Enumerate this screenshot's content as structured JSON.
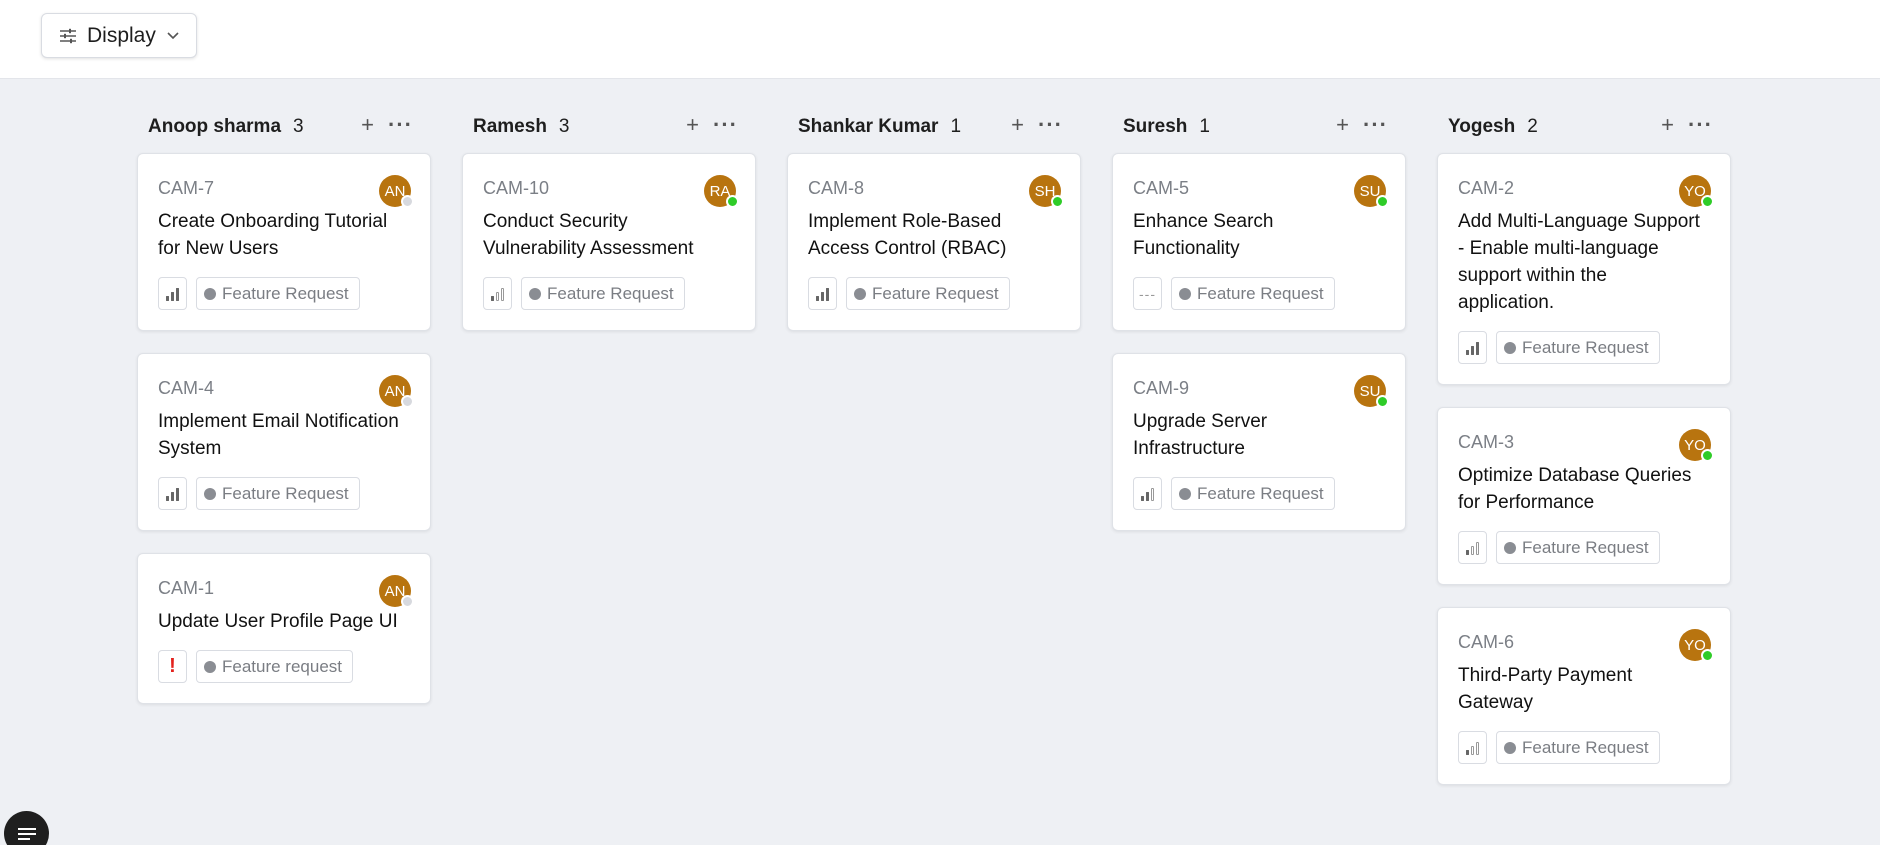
{
  "toolbar": {
    "display_label": "Display",
    "display_icon": "sliders-icon",
    "chevron_icon": "chevron-down-icon"
  },
  "columns": [
    {
      "name": "Anoop sharma",
      "count": "3",
      "cards": [
        {
          "id": "CAM-7",
          "title": "Create Onboarding Tutorial for New Users",
          "avatar": "AN",
          "presence": "offline",
          "priority": "high",
          "label": "Feature Request"
        },
        {
          "id": "CAM-4",
          "title": "Implement Email Notification System",
          "avatar": "AN",
          "presence": "offline",
          "priority": "high",
          "label": "Feature Request"
        },
        {
          "id": "CAM-1",
          "title": "Update User Profile Page UI",
          "avatar": "AN",
          "presence": "offline",
          "priority": "urgent",
          "label": "Feature request"
        }
      ]
    },
    {
      "name": "Ramesh",
      "count": "3",
      "cards": [
        {
          "id": "CAM-10",
          "title": "Conduct Security Vulnerability Assessment",
          "avatar": "RA",
          "presence": "online",
          "priority": "low",
          "label": "Feature Request"
        }
      ]
    },
    {
      "name": "Shankar Kumar",
      "count": "1",
      "cards": [
        {
          "id": "CAM-8",
          "title": "Implement Role-Based Access Control (RBAC)",
          "avatar": "SH",
          "presence": "online",
          "priority": "high",
          "label": "Feature Request"
        }
      ]
    },
    {
      "name": "Suresh",
      "count": "1",
      "cards": [
        {
          "id": "CAM-5",
          "title": "Enhance Search Functionality",
          "avatar": "SU",
          "presence": "online",
          "priority": "none",
          "label": "Feature Request"
        },
        {
          "id": "CAM-9",
          "title": "Upgrade Server Infrastructure",
          "avatar": "SU",
          "presence": "online",
          "priority": "medium",
          "label": "Feature Request"
        }
      ]
    },
    {
      "name": "Yogesh",
      "count": "2",
      "cards": [
        {
          "id": "CAM-2",
          "title": "Add Multi-Language Support - Enable multi-language support within the application.",
          "avatar": "YO",
          "presence": "online",
          "priority": "high",
          "label": "Feature Request"
        },
        {
          "id": "CAM-3",
          "title": "Optimize Database Queries for Performance",
          "avatar": "YO",
          "presence": "online",
          "priority": "low",
          "label": "Feature Request"
        },
        {
          "id": "CAM-6",
          "title": "Third-Party Payment Gateway",
          "avatar": "YO",
          "presence": "online",
          "priority": "low",
          "label": "Feature Request"
        }
      ]
    }
  ],
  "colors": {
    "avatar": "#b8740f",
    "online": "#2fcc28",
    "offline": "#d7d9de",
    "urgent": "#e3211c",
    "background": "#eef0f4"
  },
  "floating_button_icon": "menu-icon"
}
